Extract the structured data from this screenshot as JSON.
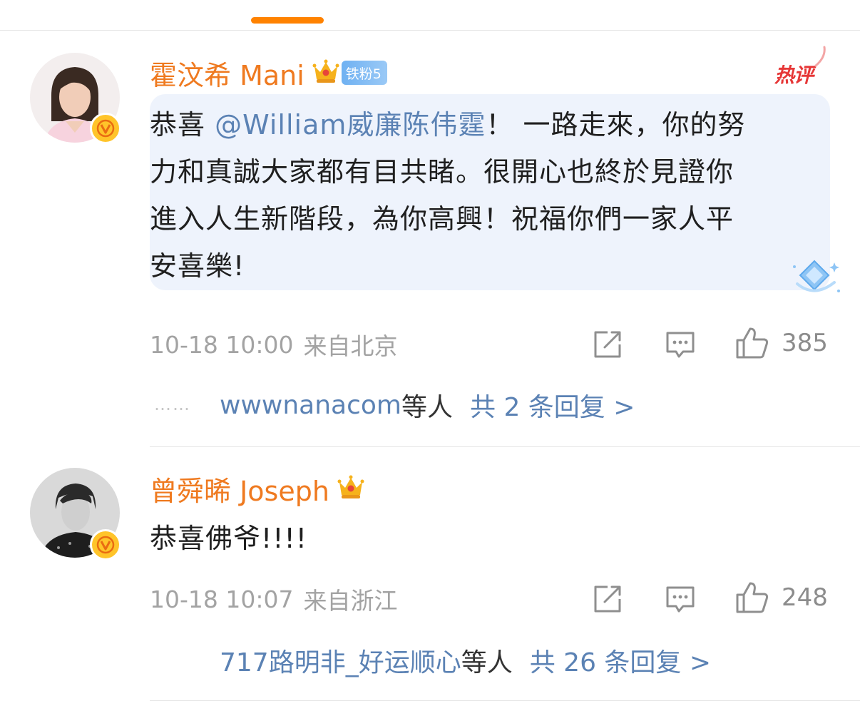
{
  "comments": [
    {
      "username": "霍汶希 Mani",
      "fan_badge": "铁粉5",
      "hot_tag": "热评",
      "text_prefix": "恭喜 ",
      "mention": "@William威廉陈伟霆",
      "text_line1_rest": "！ 一路走來，你的努",
      "text_line2": "力和真誠大家都有目共睹。很開心也終於見證你",
      "text_line3": "進入人生新階段，為你高興！祝福你們一家人平",
      "text_line4": "安喜樂!",
      "time": "10-18 10:00",
      "location": "来自北京",
      "likes": "385",
      "reply_dots": "……",
      "reply_user": "wwwnanacom",
      "reply_others": "等人",
      "reply_total": "共 2 条回复 >"
    },
    {
      "username": "曾舜晞 Joseph",
      "text": "恭喜佛爷!!!!",
      "time": "10-18 10:07",
      "location": "来自浙江",
      "likes": "248",
      "reply_user": "717路明非_好运顺心",
      "reply_others": "等人",
      "reply_total": "共 26 条回复 >"
    }
  ],
  "icons": {
    "repost": "repost-icon",
    "comment": "comment-icon",
    "like": "thumbs-up-icon",
    "verified": "verified-v-icon",
    "crown": "crown-icon"
  },
  "colors": {
    "accent_orange": "#ff8200",
    "username": "#ef7a20",
    "link_blue": "#5b82b4",
    "hot_red": "#e63737",
    "badge_yellow": "#ffc42a"
  }
}
